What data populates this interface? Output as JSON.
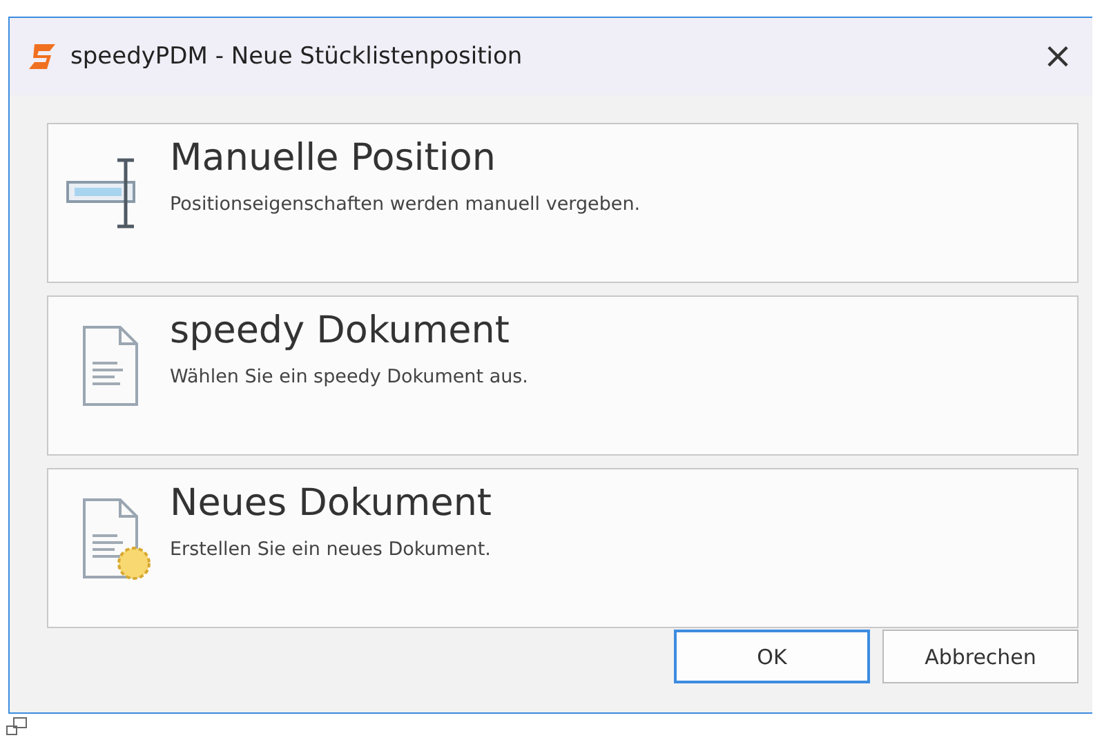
{
  "window": {
    "title": "speedyPDM - Neue Stücklistenposition",
    "close": "×"
  },
  "options": [
    {
      "kind": "manual",
      "title": "Manuelle Position",
      "description": "Positionseigenschaften werden manuell vergeben."
    },
    {
      "kind": "document",
      "title": "speedy Dokument",
      "description": "Wählen Sie ein speedy Dokument aus."
    },
    {
      "kind": "new-document",
      "title": "Neues Dokument",
      "description": "Erstellen Sie ein neues Dokument."
    }
  ],
  "buttons": [
    {
      "label": "OK",
      "default": true
    },
    {
      "label": "Abbrechen",
      "default": false
    }
  ]
}
